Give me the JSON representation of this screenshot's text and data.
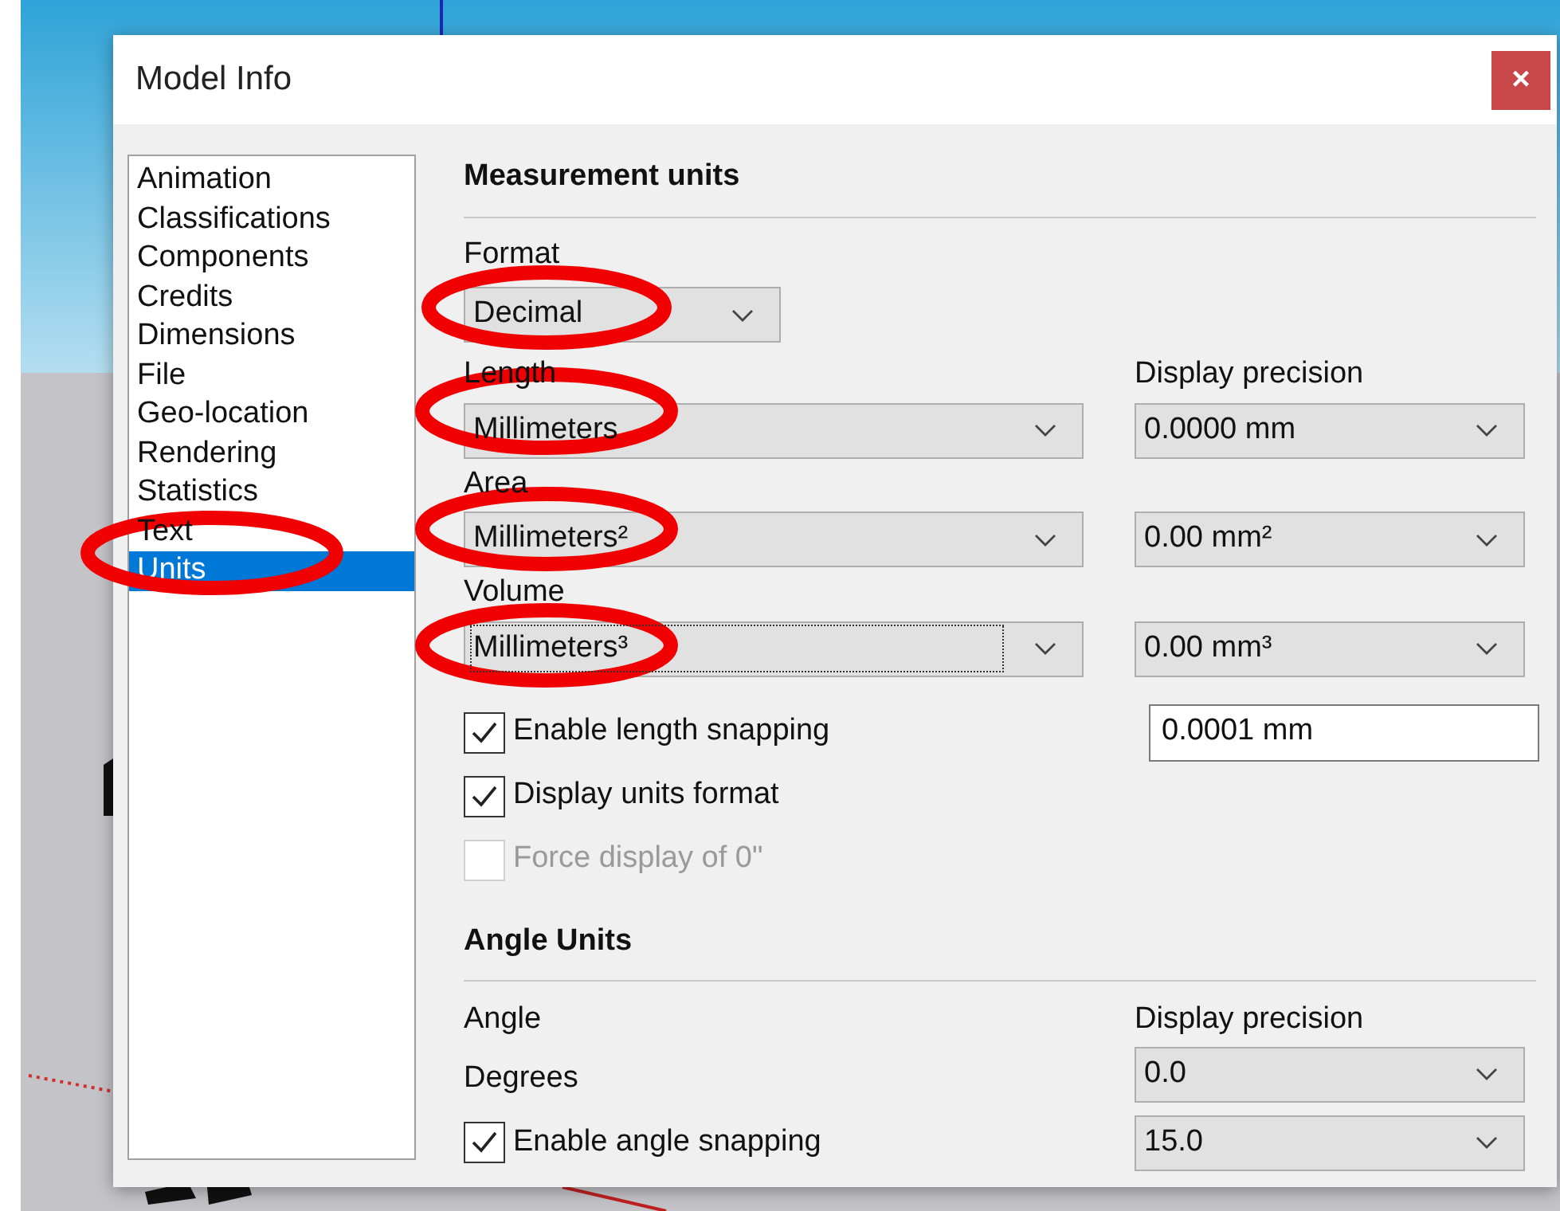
{
  "window": {
    "title": "Model Info",
    "close": "×"
  },
  "sidebar": {
    "items": [
      {
        "label": "Animation",
        "selected": false
      },
      {
        "label": "Classifications",
        "selected": false
      },
      {
        "label": "Components",
        "selected": false
      },
      {
        "label": "Credits",
        "selected": false
      },
      {
        "label": "Dimensions",
        "selected": false
      },
      {
        "label": "File",
        "selected": false
      },
      {
        "label": "Geo-location",
        "selected": false
      },
      {
        "label": "Rendering",
        "selected": false
      },
      {
        "label": "Statistics",
        "selected": false
      },
      {
        "label": "Text",
        "selected": false
      },
      {
        "label": "Units",
        "selected": true
      }
    ]
  },
  "measurement": {
    "heading": "Measurement units",
    "format": {
      "label": "Format",
      "value": "Decimal"
    },
    "precision_label": "Display precision",
    "rows": [
      {
        "label": "Length",
        "value": "Millimeters",
        "precision": "0.0000 mm",
        "focused": false
      },
      {
        "label": "Area",
        "value": "Millimeters²",
        "precision": "0.00 mm²",
        "focused": false
      },
      {
        "label": "Volume",
        "value": "Millimeters³",
        "precision": "0.00 mm³",
        "focused": true
      }
    ],
    "options": [
      {
        "label": "Enable length snapping",
        "checked": true,
        "disabled": false,
        "value": "0.0001 mm"
      },
      {
        "label": "Display units format",
        "checked": true,
        "disabled": false
      },
      {
        "label": "Force display of 0\"",
        "checked": false,
        "disabled": true
      }
    ]
  },
  "angle": {
    "heading": "Angle Units",
    "label": "Angle",
    "precision_label": "Display precision",
    "unit": "Degrees",
    "precision": "0.0",
    "snapping": {
      "label": "Enable angle snapping",
      "checked": true,
      "value": "15.0"
    }
  }
}
